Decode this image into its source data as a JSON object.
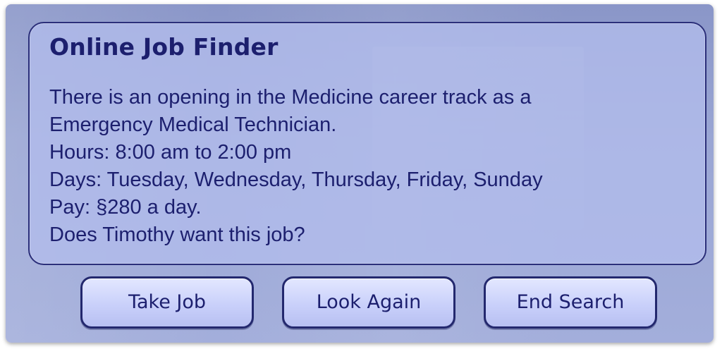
{
  "dialog": {
    "title": "Online Job Finder",
    "lines": [
      "There is an opening in the Medicine career track as a",
      "Emergency Medical Technician.",
      "Hours: 8:00 am to 2:00 pm",
      "Days: Tuesday, Wednesday, Thursday, Friday, Sunday",
      "Pay: §280 a day.",
      "Does Timothy want this job?"
    ]
  },
  "buttons": {
    "take_job": "Take Job",
    "look_again": "Look Again",
    "end_search": "End Search"
  },
  "colors": {
    "text": "#1c1f6e",
    "panel_border": "#2b2f7a",
    "panel_fill": "#b2bcec",
    "button_fill": "#c9d0fa"
  }
}
